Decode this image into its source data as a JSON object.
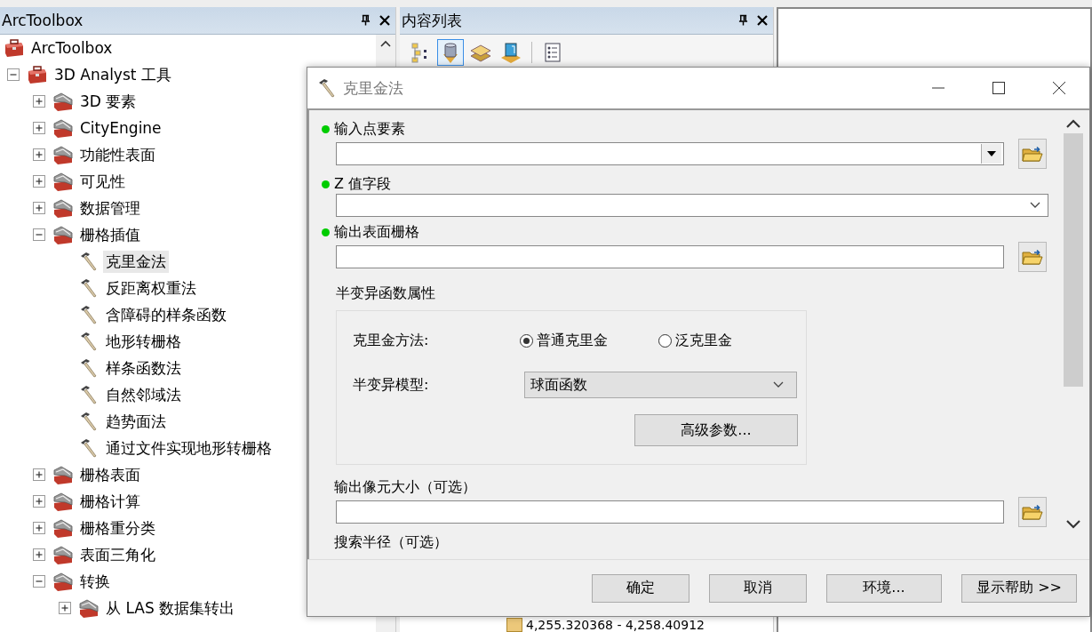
{
  "toolbox_panel": {
    "title": "ArcToolbox",
    "tree": [
      {
        "kind": "root",
        "label": "ArcToolbox",
        "selected": false,
        "children": [
          {
            "kind": "toolbox",
            "label": "3D Analyst 工具",
            "expanded": true,
            "selected": false,
            "children": [
              {
                "kind": "toolset",
                "label": "3D 要素",
                "expanded": false,
                "selected": false
              },
              {
                "kind": "toolset",
                "label": "CityEngine",
                "expanded": false,
                "selected": false
              },
              {
                "kind": "toolset",
                "label": "功能性表面",
                "expanded": false,
                "selected": false
              },
              {
                "kind": "toolset",
                "label": "可见性",
                "expanded": false,
                "selected": false
              },
              {
                "kind": "toolset",
                "label": "数据管理",
                "expanded": false,
                "selected": false
              },
              {
                "kind": "toolset",
                "label": "栅格插值",
                "expanded": true,
                "selected": false,
                "children": [
                  {
                    "kind": "tool",
                    "label": "克里金法",
                    "selected": true
                  },
                  {
                    "kind": "tool",
                    "label": "反距离权重法",
                    "selected": false
                  },
                  {
                    "kind": "tool",
                    "label": "含障碍的样条函数",
                    "selected": false
                  },
                  {
                    "kind": "tool",
                    "label": "地形转栅格",
                    "selected": false
                  },
                  {
                    "kind": "tool",
                    "label": "样条函数法",
                    "selected": false
                  },
                  {
                    "kind": "tool",
                    "label": "自然邻域法",
                    "selected": false
                  },
                  {
                    "kind": "tool",
                    "label": "趋势面法",
                    "selected": false
                  },
                  {
                    "kind": "tool",
                    "label": "通过文件实现地形转栅格",
                    "selected": false
                  }
                ]
              },
              {
                "kind": "toolset",
                "label": "栅格表面",
                "expanded": false,
                "selected": false
              },
              {
                "kind": "toolset",
                "label": "栅格计算",
                "expanded": false,
                "selected": false
              },
              {
                "kind": "toolset",
                "label": "栅格重分类",
                "expanded": false,
                "selected": false
              },
              {
                "kind": "toolset",
                "label": "表面三角化",
                "expanded": false,
                "selected": false
              },
              {
                "kind": "toolset",
                "label": "转换",
                "expanded": true,
                "selected": false,
                "children": [
                  {
                    "kind": "toolset",
                    "label": "从 LAS 数据集转出",
                    "expanded": false,
                    "selected": false
                  }
                ]
              }
            ]
          }
        ]
      }
    ]
  },
  "toc_panel": {
    "title": "内容列表",
    "toolbar": [
      {
        "kind": "drawing-order",
        "selected": false
      },
      {
        "kind": "source",
        "selected": true
      },
      {
        "kind": "visibility",
        "selected": false
      },
      {
        "kind": "selection",
        "selected": false
      },
      {
        "kind": "options",
        "selected": false
      }
    ],
    "legend_row": "4,255.320368 - 4,258.40912"
  },
  "dialog": {
    "title": "克里金法",
    "params": [
      {
        "kind": "combo-browse",
        "label": "输入点要素",
        "required": true
      },
      {
        "kind": "select",
        "label": "Z 值字段",
        "required": true
      },
      {
        "kind": "browse",
        "label": "输出表面栅格",
        "required": true
      },
      {
        "kind": "group",
        "title": "半变异函数属性",
        "method_label": "克里金方法:",
        "methods": [
          {
            "label": "普通克里金",
            "selected": true
          },
          {
            "label": "泛克里金",
            "selected": false
          }
        ],
        "model_label": "半变异模型:",
        "model_value": "球面函数",
        "advanced_button": "高级参数..."
      },
      {
        "kind": "browse",
        "label": "输出像元大小（可选）",
        "required": false
      },
      {
        "kind": "label",
        "label": "搜索半径（可选）",
        "required": false
      }
    ],
    "buttons": [
      "确定",
      "取消",
      "环境...",
      "显示帮助 >>"
    ]
  }
}
